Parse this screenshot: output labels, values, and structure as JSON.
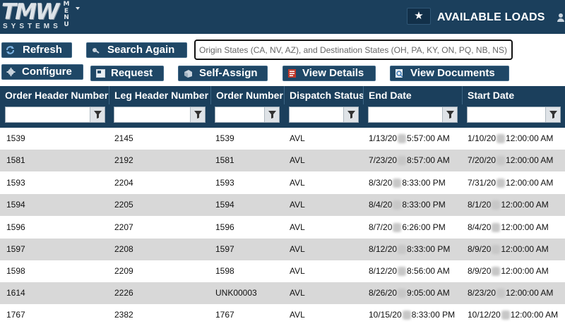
{
  "header": {
    "logo_text": "TMW",
    "logo_sub": "SYSTEMS",
    "menu_label": "MENU",
    "title": "AVAILABLE LOADS",
    "colors": {
      "bar": "#1b3f5c",
      "button": "#1f4766",
      "row_alt": "#d8d8d8"
    }
  },
  "toolbar": {
    "refresh": "Refresh",
    "search_again": "Search Again",
    "search_placeholder": "Origin States (CA, NV, AZ), and Destination States (OH, PA, KY, ON, PQ, NB, NS)",
    "search_value": "",
    "configure": "Configure",
    "request": "Request",
    "self_assign": "Self-Assign",
    "view_details": "View Details",
    "view_documents": "View Documents",
    "icons": [
      "refresh-icon",
      "search-icon",
      "gear-icon",
      "request-icon",
      "self-assign-icon",
      "details-icon",
      "documents-icon"
    ]
  },
  "grid": {
    "columns": [
      "Order Header Number",
      "Leg Header Number",
      "Order Number",
      "Dispatch Status",
      "End Date",
      "Start Date"
    ],
    "rows": [
      {
        "order_header": "1539",
        "leg_header": "2145",
        "order_number": "1539",
        "status": "AVL",
        "end_pre": "1/13/20",
        "end_post": "5:57:00 AM",
        "start_pre": "1/10/20",
        "start_post": "12:00:00 AM"
      },
      {
        "order_header": "1581",
        "leg_header": "2192",
        "order_number": "1581",
        "status": "AVL",
        "end_pre": "7/23/20",
        "end_post": "8:57:00 AM",
        "start_pre": "7/20/20",
        "start_post": "12:00:00 AM"
      },
      {
        "order_header": "1593",
        "leg_header": "2204",
        "order_number": "1593",
        "status": "AVL",
        "end_pre": "8/3/20",
        "end_post": "8:33:00 PM",
        "start_pre": "7/31/20",
        "start_post": "12:00:00 AM"
      },
      {
        "order_header": "1594",
        "leg_header": "2205",
        "order_number": "1594",
        "status": "AVL",
        "end_pre": "8/4/20",
        "end_post": "8:33:00 PM",
        "start_pre": "8/1/20",
        "start_post": "12:00:00 AM"
      },
      {
        "order_header": "1596",
        "leg_header": "2207",
        "order_number": "1596",
        "status": "AVL",
        "end_pre": "8/7/20",
        "end_post": "6:26:00 PM",
        "start_pre": "8/4/20",
        "start_post": "12:00:00 AM"
      },
      {
        "order_header": "1597",
        "leg_header": "2208",
        "order_number": "1597",
        "status": "AVL",
        "end_pre": "8/12/20",
        "end_post": "8:33:00 PM",
        "start_pre": "8/9/20",
        "start_post": "12:00:00 AM"
      },
      {
        "order_header": "1598",
        "leg_header": "2209",
        "order_number": "1598",
        "status": "AVL",
        "end_pre": "8/12/20",
        "end_post": "8:56:00 AM",
        "start_pre": "8/9/20",
        "start_post": "12:00:00 AM"
      },
      {
        "order_header": "1614",
        "leg_header": "2226",
        "order_number": "UNK00003",
        "status": "AVL",
        "end_pre": "8/26/20",
        "end_post": "9:05:00 AM",
        "start_pre": "8/23/20",
        "start_post": "12:00:00 AM"
      },
      {
        "order_header": "1767",
        "leg_header": "2382",
        "order_number": "1767",
        "status": "AVL",
        "end_pre": "10/15/20",
        "end_post": "8:33:00 PM",
        "start_pre": "10/12/20",
        "start_post": "12:00:00 AM"
      }
    ]
  }
}
